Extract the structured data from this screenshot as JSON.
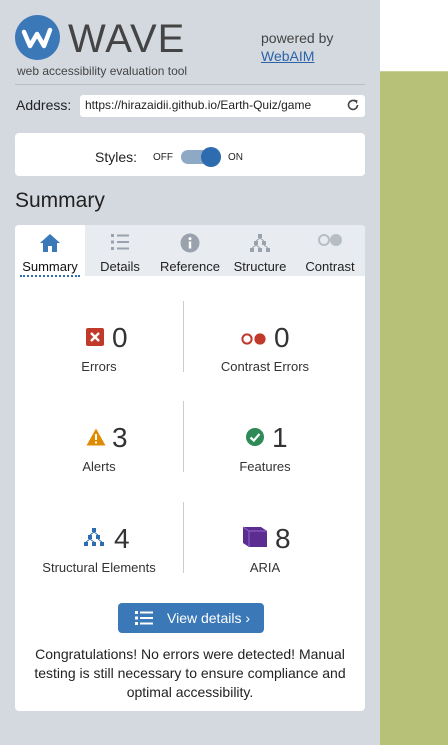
{
  "header": {
    "app_name": "WAVE",
    "tagline": "web accessibility evaluation tool",
    "powered_by": "powered by",
    "provider_link": "WebAIM"
  },
  "address": {
    "label": "Address:",
    "value": "https://hirazaidii.github.io/Earth-Quiz/game"
  },
  "styles": {
    "label": "Styles:",
    "off": "OFF",
    "on": "ON",
    "enabled": true
  },
  "summary": {
    "title": "Summary"
  },
  "tabs": [
    {
      "label": "Summary",
      "icon": "home-icon",
      "active": true
    },
    {
      "label": "Details",
      "icon": "list-icon",
      "active": false
    },
    {
      "label": "Reference",
      "icon": "info-icon",
      "active": false
    },
    {
      "label": "Structure",
      "icon": "hierarchy-icon",
      "active": false
    },
    {
      "label": "Contrast",
      "icon": "contrast-icon",
      "active": false
    }
  ],
  "stats": {
    "errors": {
      "count": "0",
      "label": "Errors",
      "icon": "error-icon"
    },
    "contrast_errors": {
      "count": "0",
      "label": "Contrast Errors",
      "icon": "contrast-error-icon"
    },
    "alerts": {
      "count": "3",
      "label": "Alerts",
      "icon": "alert-icon"
    },
    "features": {
      "count": "1",
      "label": "Features",
      "icon": "feature-icon"
    },
    "structural": {
      "count": "4",
      "label": "Structural Elements",
      "icon": "structure-icon"
    },
    "aria": {
      "count": "8",
      "label": "ARIA",
      "icon": "aria-icon"
    }
  },
  "view_details": {
    "label": "View details ›",
    "icon": "list-icon"
  },
  "message": "Congratulations! No errors were detected! Manual testing is still necessary to ensure compliance and optimal accessibility.",
  "colors": {
    "accent": "#3b78b8",
    "sidebar_bg": "#d4d9e0",
    "page_bg": "#b7c278",
    "error": "#c0392b",
    "alert": "#e08a00",
    "feature": "#2e8b57",
    "aria": "#5c2d91"
  }
}
